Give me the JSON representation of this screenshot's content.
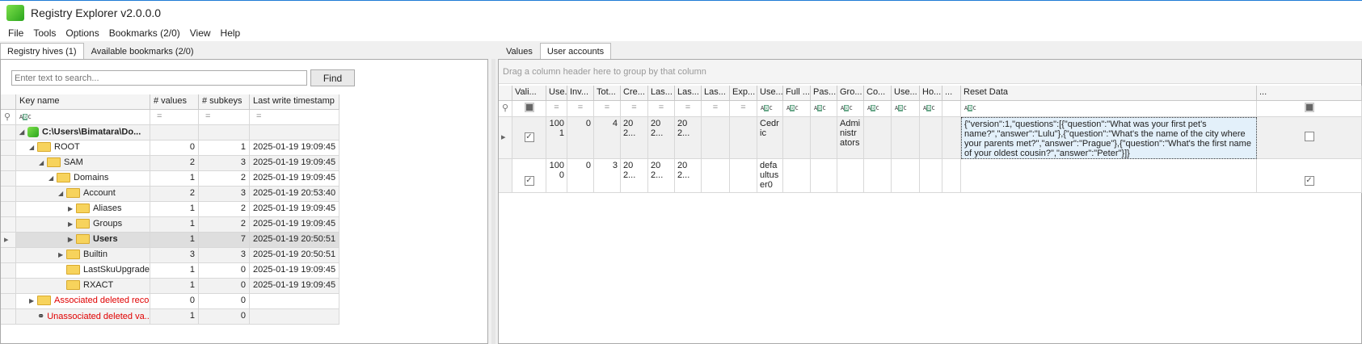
{
  "app": {
    "title": "Registry Explorer v2.0.0.0"
  },
  "menu": [
    "File",
    "Tools",
    "Options",
    "Bookmarks (2/0)",
    "View",
    "Help"
  ],
  "left": {
    "tabs": [
      {
        "label": "Registry hives (1)",
        "active": true
      },
      {
        "label": "Available bookmarks (2/0)",
        "active": false
      }
    ],
    "search_placeholder": "Enter text to search...",
    "find_label": "Find",
    "columns": [
      "Key name",
      "# values",
      "# subkeys",
      "Last write timestamp"
    ],
    "filter_symbol": "=",
    "rows": [
      {
        "name": "C:\\Users\\Bimatara\\Do...",
        "level": 0,
        "values": "",
        "subkeys": "",
        "ts": "",
        "expander": "expanded",
        "icon": "hive",
        "bold": true
      },
      {
        "name": "ROOT",
        "level": 1,
        "values": "0",
        "subkeys": "1",
        "ts": "2025-01-19 19:09:45",
        "expander": "expanded",
        "icon": "folder"
      },
      {
        "name": "SAM",
        "level": 2,
        "values": "2",
        "subkeys": "3",
        "ts": "2025-01-19 19:09:45",
        "expander": "expanded",
        "icon": "folder"
      },
      {
        "name": "Domains",
        "level": 3,
        "values": "1",
        "subkeys": "2",
        "ts": "2025-01-19 19:09:45",
        "expander": "expanded",
        "icon": "folder"
      },
      {
        "name": "Account",
        "level": 4,
        "values": "2",
        "subkeys": "3",
        "ts": "2025-01-19 20:53:40",
        "expander": "expanded",
        "icon": "folder"
      },
      {
        "name": "Aliases",
        "level": 5,
        "values": "1",
        "subkeys": "2",
        "ts": "2025-01-19 19:09:45",
        "expander": "collapsed",
        "icon": "folder"
      },
      {
        "name": "Groups",
        "level": 5,
        "values": "1",
        "subkeys": "2",
        "ts": "2025-01-19 19:09:45",
        "expander": "collapsed",
        "icon": "folder"
      },
      {
        "name": "Users",
        "level": 5,
        "values": "1",
        "subkeys": "7",
        "ts": "2025-01-19 20:50:51",
        "expander": "collapsed",
        "icon": "folder",
        "bold": true,
        "selected": true
      },
      {
        "name": "Builtin",
        "level": 4,
        "values": "3",
        "subkeys": "3",
        "ts": "2025-01-19 20:50:51",
        "expander": "collapsed",
        "icon": "folder"
      },
      {
        "name": "LastSkuUpgrade",
        "level": 4,
        "values": "1",
        "subkeys": "0",
        "ts": "2025-01-19 19:09:45",
        "expander": "none",
        "icon": "folder"
      },
      {
        "name": "RXACT",
        "level": 4,
        "values": "1",
        "subkeys": "0",
        "ts": "2025-01-19 19:09:45",
        "expander": "none",
        "icon": "folder"
      },
      {
        "name": "Associated deleted recor...",
        "level": 1,
        "values": "0",
        "subkeys": "0",
        "ts": "",
        "expander": "collapsed",
        "icon": "warning-folder",
        "red": true
      },
      {
        "name": "Unassociated deleted va...",
        "level": 1,
        "values": "1",
        "subkeys": "0",
        "ts": "",
        "expander": "none",
        "icon": "deleted-value",
        "red": true
      }
    ]
  },
  "right": {
    "tabs": [
      {
        "label": "Values",
        "active": false
      },
      {
        "label": "User accounts",
        "active": true
      }
    ],
    "group_hint": "Drag a column header here to group by that column",
    "columns": [
      "Vali...",
      "Use...",
      "Inv...",
      "Tot...",
      "Cre...",
      "Las...",
      "Las...",
      "Las...",
      "Exp...",
      "Use...",
      "Full ...",
      "Pas...",
      "Gro...",
      "Co...",
      "Use...",
      "Ho...",
      "...",
      "Reset Data",
      "..."
    ],
    "filter_types": [
      "check",
      "=",
      "=",
      "=",
      "=",
      "=",
      "=",
      "=",
      "=",
      "abc",
      "abc",
      "abc",
      "abc",
      "abc",
      "abc",
      "abc",
      "",
      "abc",
      "check"
    ],
    "rows": [
      {
        "cells": [
          "check",
          "1001",
          "0",
          "4",
          "202...",
          "202...",
          "202...",
          "",
          "",
          "Cedric",
          "",
          "",
          "Administrators",
          "",
          "",
          "",
          "",
          "{\"version\":1,\"questions\":[{\"question\":\"What was your first pet's name?\",\"answer\":\"Lulu\"},{\"question\":\"What's the name of the city where your parents met?\",\"answer\":\"Prague\"},{\"question\":\"What's the first name of your oldest cousin?\",\"answer\":\"Peter\"}]}",
          "uncheck"
        ],
        "selected": true
      },
      {
        "cells": [
          "check",
          "1000",
          "0",
          "3",
          "202...",
          "202...",
          "202...",
          "",
          "",
          "defaultuser0",
          "",
          "",
          "",
          "",
          "",
          "",
          "",
          "",
          "check"
        ]
      }
    ]
  }
}
